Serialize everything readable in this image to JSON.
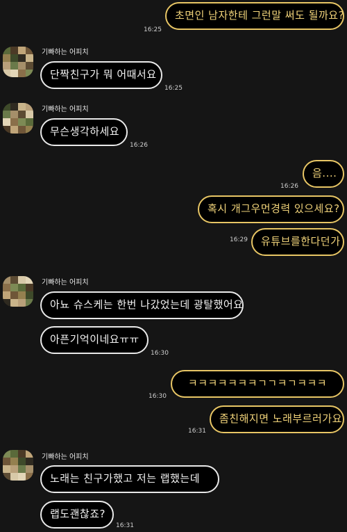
{
  "contact": {
    "name": "기빠하는 어피치"
  },
  "messages": [
    {
      "side": "out",
      "text": "초면인 남자한테 그런말 써도 될까요?",
      "time": "16:25"
    },
    {
      "side": "in",
      "text": "단짝친구가 뭐 어때서요",
      "time": "16:25"
    },
    {
      "side": "in",
      "text": "무슨생각하세요",
      "time": "16:26"
    },
    {
      "side": "out",
      "text": "음....",
      "time": "16:26"
    },
    {
      "side": "out",
      "text": "혹시 개그우먼경력 있으세요?",
      "time": ""
    },
    {
      "side": "out",
      "text": "유튜브를한다던가",
      "time": "16:29"
    },
    {
      "side": "in",
      "text": "아뇨 슈스케는 한번 나갔었는데 광탈했어요",
      "time": ""
    },
    {
      "side": "in",
      "text": "아픈기억이네요ㅠㅠ",
      "time": "16:30"
    },
    {
      "side": "out",
      "text": "ㅋㅋㅋㅋㅋㅋㅋㄱㄱㅋㄱㅋㅋㅋ",
      "time": "16:30"
    },
    {
      "side": "out",
      "text": "좀친해지면 노래부르러가요",
      "time": "16:31"
    },
    {
      "side": "in",
      "text": "노래는 친구가했고 저는 랩했는데",
      "time": ""
    },
    {
      "side": "in",
      "text": "랩도괜찮죠?",
      "time": "16:31"
    }
  ],
  "colors": {
    "background": "#151515",
    "outgoing_border": "#e8c665",
    "outgoing_text": "#f1d37a",
    "incoming_border": "#e9e9e9",
    "incoming_text": "#f4f4f4"
  }
}
